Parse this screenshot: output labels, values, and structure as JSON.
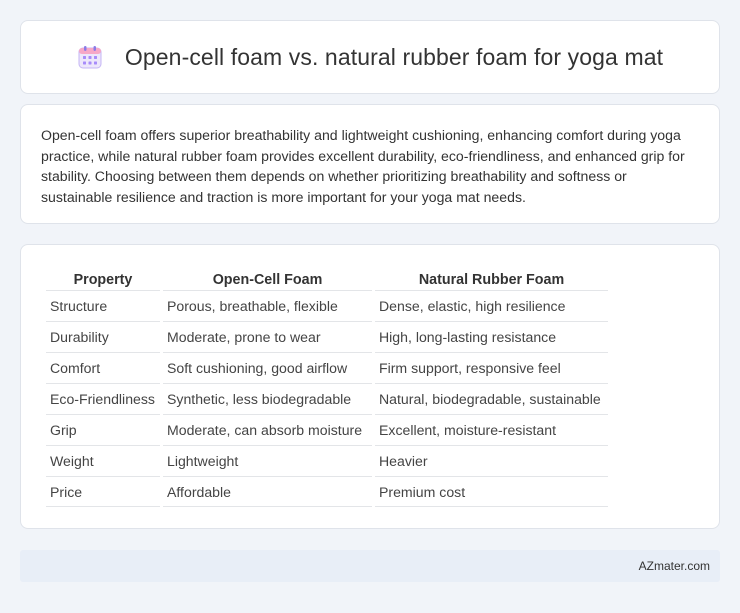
{
  "header": {
    "title": "Open-cell foam vs. natural rubber foam for yoga mat",
    "icon": "calendar-icon",
    "icon_color": "#a78bfa"
  },
  "summary": {
    "text": "Open-cell foam offers superior breathability and lightweight cushioning, enhancing comfort during yoga practice, while natural rubber foam provides excellent durability, eco-friendliness, and enhanced grip for stability. Choosing between them depends on whether prioritizing breathability and softness or sustainable resilience and traction is more important for your yoga mat needs."
  },
  "table": {
    "headers": [
      "Property",
      "Open-Cell Foam",
      "Natural Rubber Foam"
    ],
    "rows": [
      [
        "Structure",
        "Porous, breathable, flexible",
        "Dense, elastic, high resilience"
      ],
      [
        "Durability",
        "Moderate, prone to wear",
        "High, long-lasting resistance"
      ],
      [
        "Comfort",
        "Soft cushioning, good airflow",
        "Firm support, responsive feel"
      ],
      [
        "Eco-Friendliness",
        "Synthetic, less biodegradable",
        "Natural, biodegradable, sustainable"
      ],
      [
        "Grip",
        "Moderate, can absorb moisture",
        "Excellent, moisture-resistant"
      ],
      [
        "Weight",
        "Lightweight",
        "Heavier"
      ],
      [
        "Price",
        "Affordable",
        "Premium cost"
      ]
    ]
  },
  "footer": {
    "brand": "AZmater.com"
  }
}
